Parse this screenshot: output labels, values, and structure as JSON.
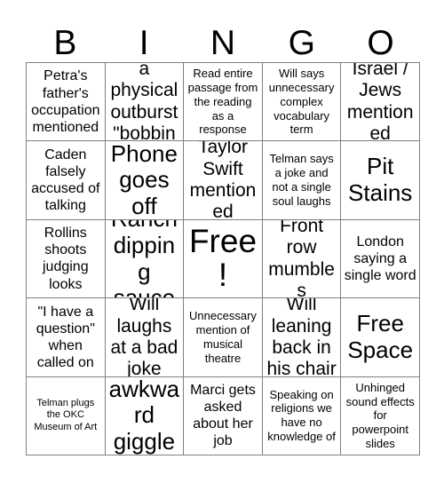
{
  "header": {
    "letters": [
      "B",
      "I",
      "N",
      "G",
      "O"
    ]
  },
  "grid": {
    "rows": 5,
    "columns": 5,
    "border_color": "#808080",
    "background_color": "#ffffff",
    "text_color": "#000000",
    "cells": [
      {
        "text": "Petra's father's occupation mentioned",
        "size": "sz-md"
      },
      {
        "text": "Lisa has a physical outburst \"bobbing\"",
        "size": "sz-lg"
      },
      {
        "text": "Read entire passage from the reading as a response",
        "size": "sz-sm"
      },
      {
        "text": "Will says unnecessary complex vocabulary term",
        "size": "sz-sm"
      },
      {
        "text": "Israel / Jews mentioned",
        "size": "sz-lg"
      },
      {
        "text": "Caden falsely accused of talking",
        "size": "sz-md"
      },
      {
        "text": "Phone goes off",
        "size": "sz-xl"
      },
      {
        "text": "Taylor Swift mentioned",
        "size": "sz-lg"
      },
      {
        "text": "Telman says a joke and not a single soul laughs",
        "size": "sz-sm"
      },
      {
        "text": "Pit Stains",
        "size": "sz-xl"
      },
      {
        "text": "Rollins shoots judging looks",
        "size": "sz-md"
      },
      {
        "text": "Ranch dipping sauce",
        "size": "sz-xl"
      },
      {
        "text": "Free!",
        "size": "sz-xxl"
      },
      {
        "text": "Front row mumbles",
        "size": "sz-lg"
      },
      {
        "text": "London saying a single word",
        "size": "sz-md"
      },
      {
        "text": "\"I have a question\" when called on",
        "size": "sz-md"
      },
      {
        "text": "Will laughs at a bad joke",
        "size": "sz-lg"
      },
      {
        "text": "Unnecessary mention of musical theatre",
        "size": "sz-sm"
      },
      {
        "text": "Will leaning back in his chair",
        "size": "sz-lg"
      },
      {
        "text": "Free Space",
        "size": "sz-xl"
      },
      {
        "text": "Telman plugs the OKC Museum of Art",
        "size": "sz-xs"
      },
      {
        "text": "Corey awkward giggles",
        "size": "sz-xl"
      },
      {
        "text": "Marci gets asked about her job",
        "size": "sz-md"
      },
      {
        "text": "Speaking on religions we have no knowledge of",
        "size": "sz-sm"
      },
      {
        "text": "Unhinged sound effects for powerpoint slides",
        "size": "sz-sm"
      }
    ]
  }
}
